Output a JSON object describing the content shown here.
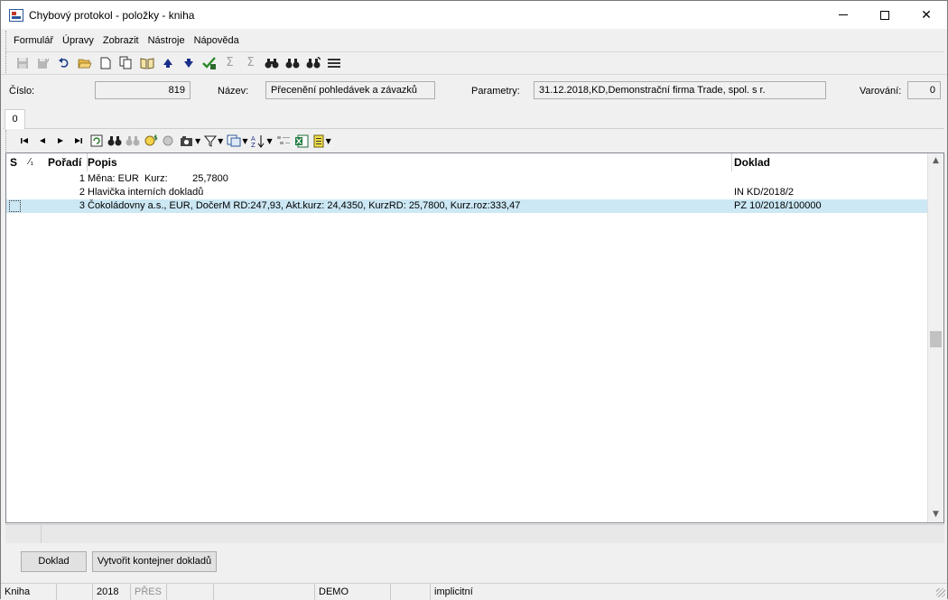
{
  "window": {
    "title": "Chybový protokol - položky - kniha",
    "minimize": "",
    "maximize": "",
    "close": "✕"
  },
  "menu": [
    "Formulář",
    "Úpravy",
    "Zobrazit",
    "Nástroje",
    "Nápověda"
  ],
  "toolbar_icons": [
    "save-icon",
    "save-as-icon",
    "undo-icon",
    "open-folder-icon",
    "new-document-icon",
    "copy-icon",
    "book-icon",
    "arrow-up-icon",
    "arrow-down-icon",
    "check-icon",
    "sum-icon",
    "sum-filter-icon",
    "binoculars-icon",
    "binoculars-next-icon",
    "binoculars-replace-icon",
    "menu-lines-icon"
  ],
  "header": {
    "cislo_label": "Číslo:",
    "cislo_value": "819",
    "nazev_label": "Název:",
    "nazev_value": "Přecenění pohledávek a závazků",
    "parametry_label": "Parametry:",
    "parametry_value": "31.12.2018,KD,Demonstrační firma Trade, spol. s r.",
    "varovani_label": "Varování:",
    "varovani_value": "0"
  },
  "tabs": [
    "0"
  ],
  "grid": {
    "columns": {
      "s": "S",
      "sort": "⁄₁",
      "poradi": "Pořadí",
      "popis": "Popis",
      "doklad": "Doklad"
    },
    "rows": [
      {
        "poradi": "1",
        "popis": "Měna: EUR  Kurz:         25,7800",
        "doklad": "",
        "selected": false
      },
      {
        "poradi": "2",
        "popis": "Hlavička interních dokladů",
        "doklad": "IN KD/2018/2",
        "selected": false
      },
      {
        "poradi": "3",
        "popis": "Čokoládovny a.s., EUR, DočerM RD:247,93, Akt.kurz: 24,4350, KurzRD: 25,7800, Kurz.roz:333,47",
        "doklad": "PZ 10/2018/100000",
        "selected": true
      }
    ]
  },
  "buttons": {
    "doklad": "Doklad",
    "vytvorit": "Vytvořit kontejner dokladů"
  },
  "statusbar": {
    "kniha": "Kniha",
    "year": "2018",
    "mode": "PŘES",
    "demo": "DEMO",
    "implicitni": "implicitní"
  }
}
